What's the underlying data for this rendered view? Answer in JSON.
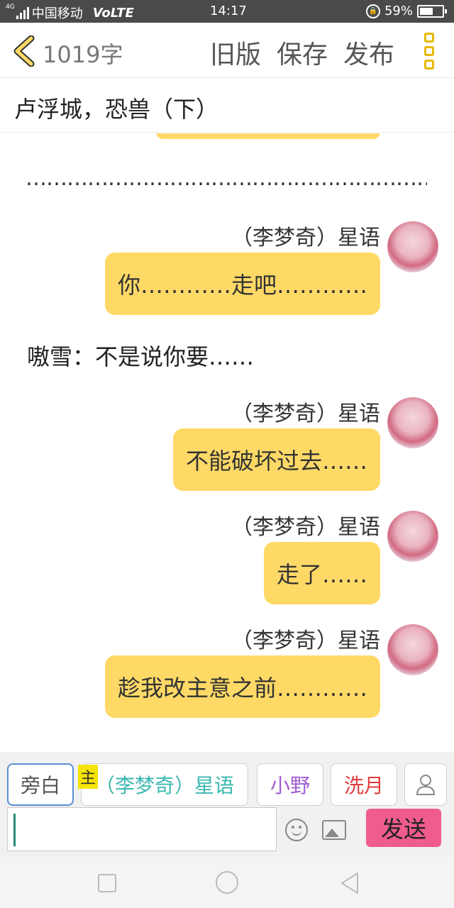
{
  "status_bar": {
    "network": "4G",
    "carrier": "中国移动",
    "volte": "VoLTE",
    "time": "14:17",
    "battery_percent": "59%",
    "battery_level": 0.59
  },
  "header": {
    "word_count": "1019字",
    "old_version_label": "旧版",
    "save_label": "保存",
    "publish_label": "发布"
  },
  "title": "卢浮城，恐兽（下）",
  "chat": {
    "separator": "…………………………………………………………",
    "messages": [
      {
        "speaker": "（李梦奇）星语",
        "text": "你…………走吧…………"
      },
      {
        "speaker": "（李梦奇）星语",
        "text": "不能破坏过去……"
      },
      {
        "speaker": "（李梦奇）星语",
        "text": "走了……"
      },
      {
        "speaker": "（李梦奇）星语",
        "text": "趁我改主意之前…………"
      }
    ],
    "narration": "嗷雪：不是说你要……"
  },
  "input_area": {
    "roles": [
      {
        "label": "旁白",
        "color": "#555555"
      },
      {
        "label": "（李梦奇）星语",
        "color": "#3ab8b0"
      },
      {
        "label": "小野",
        "color": "#a05cd0"
      },
      {
        "label": "洗月",
        "color": "#e03c3c"
      }
    ],
    "main_tag": "主",
    "input_value": "",
    "send_label": "发送"
  },
  "colors": {
    "bubble": "#ffd966",
    "accent": "#e8b800",
    "send": "#f05c8f"
  }
}
